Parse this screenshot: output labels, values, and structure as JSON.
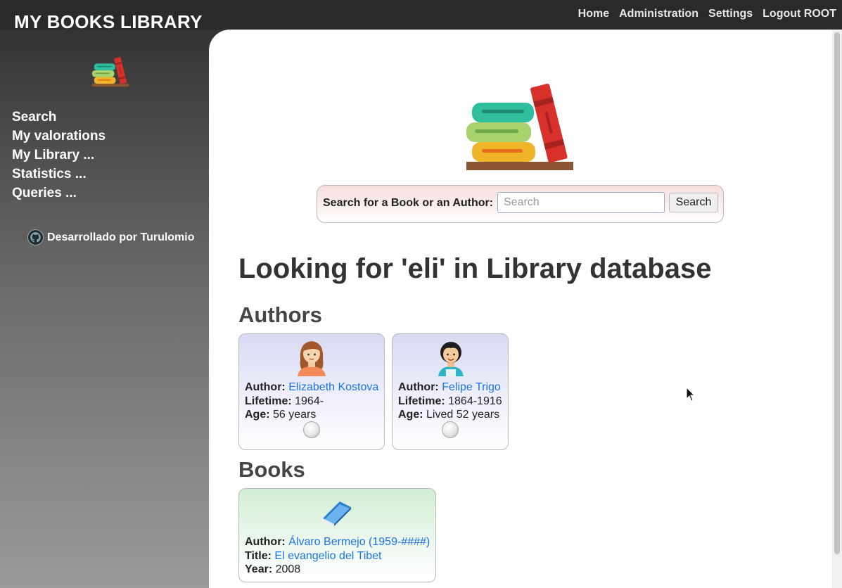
{
  "header": {
    "brand": "MY BOOKS LIBRARY",
    "nav": [
      "Home",
      "Administration",
      "Settings",
      "Logout ROOT"
    ]
  },
  "sidebar": {
    "items": [
      "Search",
      "My valorations",
      "My Library ...",
      "Statistics ...",
      "Queries ..."
    ],
    "credit": "Desarrollado por Turulomio"
  },
  "search": {
    "label": "Search for a Book or an Author:",
    "placeholder": "Search",
    "value": "",
    "button": "Search"
  },
  "main": {
    "title": "Looking for 'eli' in Library database",
    "authors_heading": "Authors",
    "books_heading": "Books"
  },
  "authors": [
    {
      "author_label": "Author:",
      "name": "Elizabeth Kostova",
      "lifetime_label": "Lifetime:",
      "lifetime": "1964-",
      "age_label": "Age:",
      "age": "56 years",
      "avatar_icon": "woman-avatar-icon"
    },
    {
      "author_label": "Author:",
      "name": "Felipe Trigo",
      "lifetime_label": "Lifetime:",
      "lifetime": "1864-1916",
      "age_label": "Age:",
      "age": "Lived 52 years",
      "avatar_icon": "man-avatar-icon"
    }
  ],
  "books": [
    {
      "author_label": "Author:",
      "author": "Álvaro Bermejo (1959-####)",
      "title_label": "Title:",
      "title": "El evangelio del Tibet",
      "year_label": "Year:",
      "year": "2008",
      "icon": "book-icon"
    }
  ],
  "colors": {
    "topbar": "#2a2a2a",
    "link": "#1a73e8",
    "author_card": "#d8daf2",
    "book_card": "#d2eed5",
    "search_box": "#f6dede"
  }
}
